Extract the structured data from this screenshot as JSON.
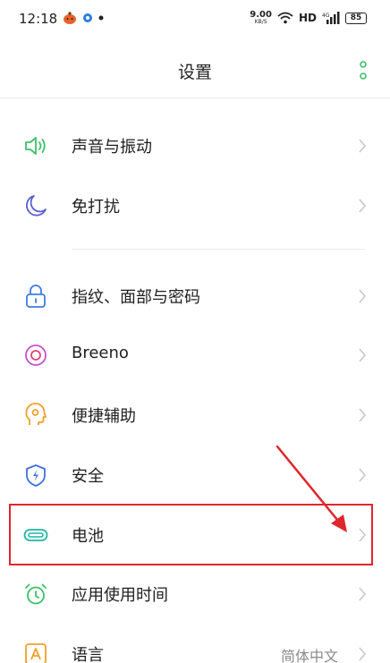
{
  "status_bar": {
    "time": "12:18",
    "net_speed_value": "9.00",
    "net_speed_unit": "KB/S",
    "network_type": "HD",
    "battery_level": "85"
  },
  "header": {
    "title": "设置"
  },
  "settings": {
    "sound": {
      "label": "声音与振动",
      "icon": "speaker-icon"
    },
    "dnd": {
      "label": "免打扰",
      "icon": "moon-icon"
    },
    "fingerprint": {
      "label": "指纹、面部与密码",
      "icon": "lock-icon"
    },
    "breeno": {
      "label": "Breeno",
      "icon": "breeno-icon"
    },
    "accessibility": {
      "label": "便捷辅助",
      "icon": "assist-icon"
    },
    "security": {
      "label": "安全",
      "icon": "shield-icon"
    },
    "battery": {
      "label": "电池",
      "icon": "battery-icon"
    },
    "app_usage": {
      "label": "应用使用时间",
      "icon": "alarm-clock-icon"
    },
    "language": {
      "label": "语言",
      "value": "简体中文",
      "icon": "language-icon"
    }
  },
  "colors": {
    "accent_green": "#3cc06b",
    "highlight_red": "#e0262d",
    "chevron": "#c8c8c8"
  }
}
